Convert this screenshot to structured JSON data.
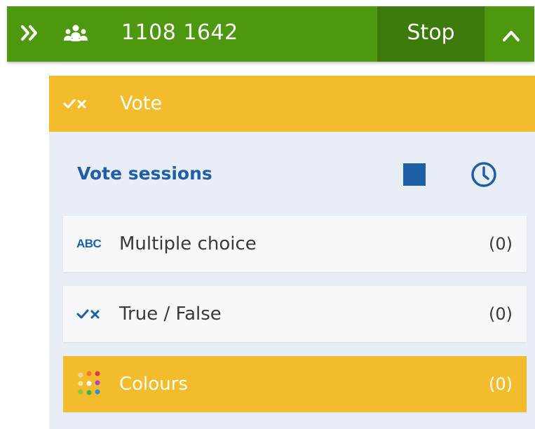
{
  "topbar": {
    "session_code": "1108 1642",
    "stop_label": "Stop",
    "icons": {
      "expand": "double-chevron-right-icon",
      "participants": "people-icon",
      "collapse": "chevron-up-icon"
    },
    "color": "#4d980f"
  },
  "vote_panel": {
    "header_label": "Vote",
    "header_icon": "check-cross-icon",
    "sessions_title": "Vote sessions",
    "actions": {
      "stop": "stop-square-icon",
      "history": "clock-icon"
    },
    "accent": "#f3bc2c",
    "link_color": "#1f5fa8",
    "items": [
      {
        "label": "Multiple choice",
        "icon_text": "ABC",
        "icon": "abc-icon",
        "count": "(0)"
      },
      {
        "label": "True / False",
        "icon": "check-cross-icon",
        "count": "(0)"
      },
      {
        "label": "Colours",
        "icon": "color-dots-icon",
        "count": "(0)",
        "selected": true
      }
    ]
  }
}
